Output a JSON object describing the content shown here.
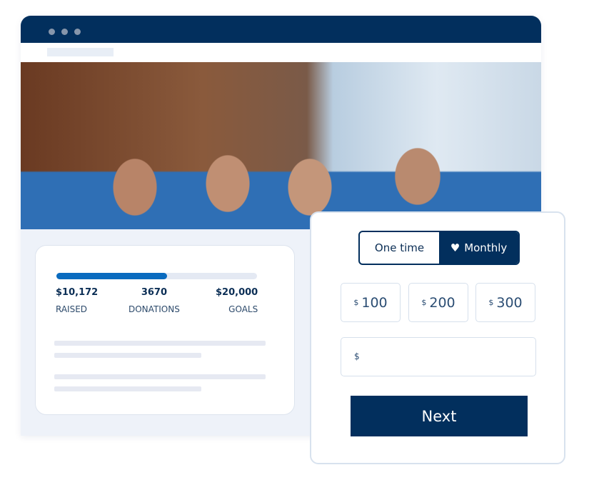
{
  "browser": {
    "dots": 3
  },
  "campaign": {
    "progress_fraction": 0.55,
    "raised": {
      "value": "$10,172",
      "label": "RAISED"
    },
    "donations": {
      "value": "3670",
      "label": "DONATIONS"
    },
    "goal": {
      "value": "$20,000",
      "label": "GOALS"
    }
  },
  "donation_form": {
    "frequency": {
      "options": [
        "One time",
        "Monthly"
      ],
      "selected": "Monthly",
      "one_time": "One time",
      "monthly": "Monthly"
    },
    "currency": "$",
    "amounts": [
      "100",
      "200",
      "300"
    ],
    "custom_amount": "",
    "next_label": "Next"
  },
  "colors": {
    "brand": "#022f5d",
    "progress": "#0a6bbf"
  }
}
